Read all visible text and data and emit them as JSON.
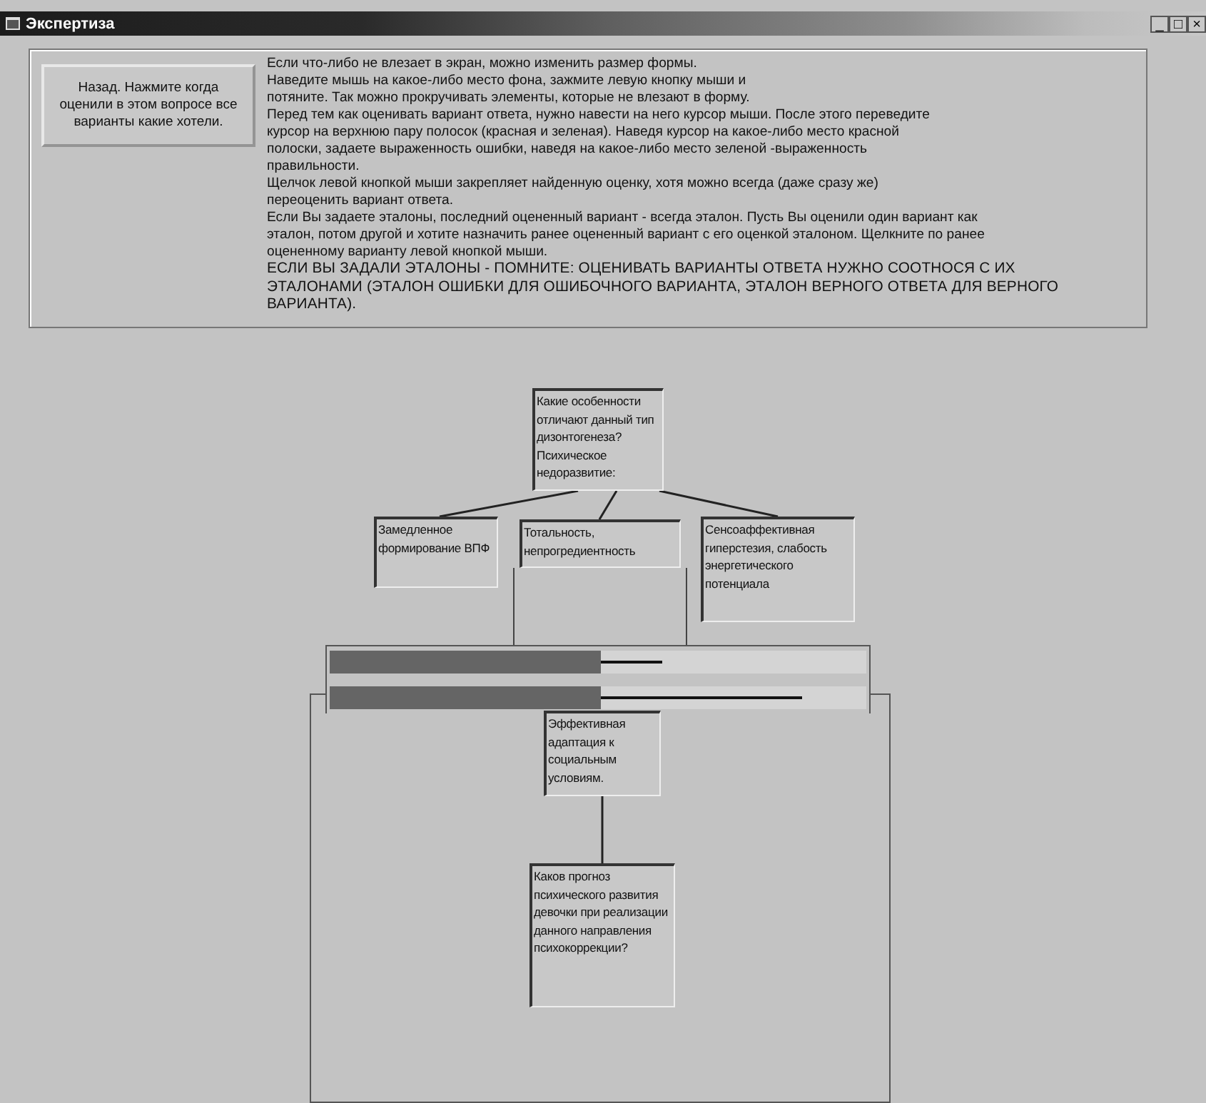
{
  "window": {
    "title": "Экспертиза",
    "controls": [
      "_",
      "□",
      "×"
    ]
  },
  "back_button": {
    "label": "Назад. Нажмите когда оценили в этом вопросе все варианты какие хотели."
  },
  "instructions": [
    {
      "kind": "normal",
      "text": "Если что-либо не влезает в экран, можно изменить размер формы.\nНаведите мышь на какое-либо место фона, зажмите левую кнопку мыши и\nпотяните. Так можно  прокручивать элементы, которые не влезают в форму."
    },
    {
      "kind": "normal",
      "text": "Перед тем как оценивать вариант ответа, нужно навести на него курсор мыши. После этого переведите\nкурсор на верхнюю пару полосок (красная и зеленая). Наведя курсор на какое-либо место красной\nполоски, задаете выраженность ошибки, наведя на какое-либо место зеленой -выраженность\nправильности."
    },
    {
      "kind": "normal",
      "text": "Щелчок левой кнопкой мыши закрепляет найденную оценку, хотя можно всегда (даже сразу же)\nпереоценить вариант ответа."
    },
    {
      "kind": "normal",
      "text": "Если Вы задаете эталоны, последний оцененный вариант - всегда эталон. Пусть Вы оценили один вариант как\nэталон, потом другой и хотите назначить ранее оцененный вариант с его оценкой эталоном. Щелкните по ранее\nоцененному варианту левой кнопкой мыши."
    },
    {
      "kind": "warning",
      "text": "ЕСЛИ ВЫ ЗАДАЛИ ЭТАЛОНЫ - ПОМНИТЕ: ОЦЕНИВАТЬ ВАРИАНТЫ ОТВЕТА НУЖНО СООТНОСЯ С ИХ\nЭТАЛОНАМИ (ЭТАЛОН ОШИБКИ ДЛЯ ОШИБОЧНОГО ВАРИАНТА, ЭТАЛОН ВЕРНОГО ОТВЕТА ДЛЯ ВЕРНОГО\nВАРИАНТА)."
    }
  ],
  "nodes": [
    {
      "text": "Какие особенности отличают данный тип дизонтогенеза? Психическое недоразвитие:"
    },
    {
      "text": "Замедленное формирование ВПФ"
    },
    {
      "text": "Тотальность, непрогредиентность"
    },
    {
      "text": "Сенсоаффективная гиперстезия, слабость энергетического потенциала"
    },
    {
      "text": "Эффективная адаптация  к социальным условиям."
    },
    {
      "text": "Каков прогноз психического развития девочки при реализации данного направления психокоррекции?"
    }
  ],
  "scales": [
    {
      "fill": {
        "level": 0.505
      },
      "marker": {
        "level": 0.62
      }
    },
    {
      "fill": {
        "level": 0.505
      },
      "marker": {
        "level": 0.88
      }
    }
  ]
}
